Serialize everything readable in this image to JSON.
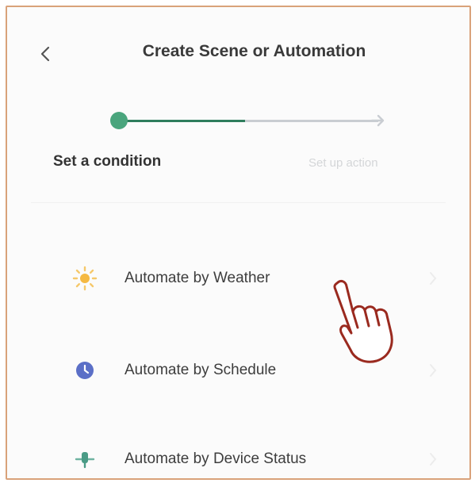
{
  "header": {
    "title": "Create Scene or Automation",
    "back_icon": "chevron-left-icon"
  },
  "stepper": {
    "steps": [
      {
        "label": "Set a condition",
        "state": "active"
      },
      {
        "label": "Set up action",
        "state": "inactive"
      }
    ],
    "active_color": "#4aa57d",
    "inactive_color": "#c9cdd2"
  },
  "options": [
    {
      "label": "Automate by Weather",
      "icon": "sun-icon",
      "icon_color": "#f5b942"
    },
    {
      "label": "Automate by Schedule",
      "icon": "clock-icon",
      "icon_color": "#5b6fc7"
    },
    {
      "label": "Automate by Device Status",
      "icon": "device-icon",
      "icon_color": "#4a9b86"
    }
  ],
  "pointer": {
    "icon": "pointing-hand-icon",
    "target": "Automate by Weather"
  },
  "colors": {
    "frame_border": "#d9a27a",
    "hand_stroke": "#9a2a1f"
  }
}
